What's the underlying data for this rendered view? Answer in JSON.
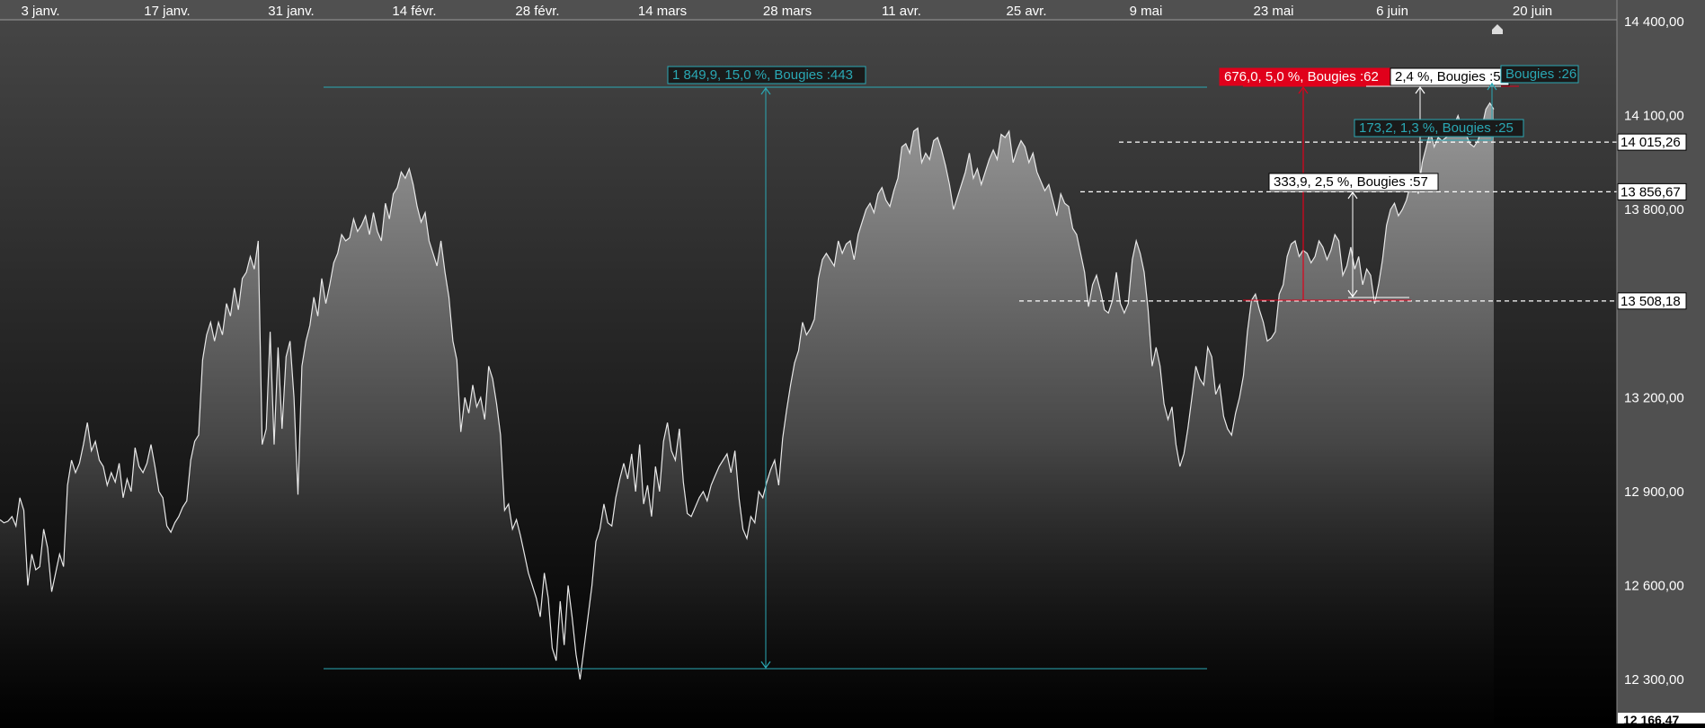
{
  "chart_data": {
    "type": "area",
    "title": "",
    "x_axis": {
      "ticks": [
        "3 janv.",
        "17 janv.",
        "31 janv.",
        "14 févr.",
        "28 févr.",
        "14 mars",
        "28 mars",
        "11 avr.",
        "25 avr.",
        "9 mai",
        "23 mai",
        "6 juin",
        "20 juin"
      ]
    },
    "y_axis": {
      "ticks": [
        14400,
        14100,
        13800,
        13200,
        12900,
        12600,
        12300
      ],
      "tick_labels": [
        "14 400,00",
        "14 100,00",
        "13 800,00",
        "13 200,00",
        "12 900,00",
        "12 600,00",
        "12 300,00"
      ],
      "ylim": [
        12166.47,
        14400
      ],
      "bottom_label": "12 166,47"
    },
    "series": [
      {
        "values": [
          12810,
          12800,
          12805,
          12820,
          12790,
          12880,
          12840,
          12600,
          12700,
          12650,
          12660,
          12780,
          12720,
          12580,
          12640,
          12700,
          12660,
          12920,
          13000,
          12960,
          12990,
          13050,
          13120,
          13030,
          13060,
          13000,
          12980,
          12920,
          12960,
          12930,
          12990,
          12880,
          12940,
          12900,
          13040,
          12980,
          12960,
          12990,
          13050,
          12980,
          12900,
          12880,
          12790,
          12770,
          12800,
          12820,
          12850,
          12870,
          13000,
          13060,
          13080,
          13320,
          13400,
          13440,
          13380,
          13440,
          13400,
          13500,
          13460,
          13550,
          13480,
          13580,
          13600,
          13650,
          13610,
          13700,
          13050,
          13100,
          13410,
          13050,
          13360,
          13100,
          13330,
          13380,
          13200,
          12890,
          13300,
          13380,
          13430,
          13520,
          13460,
          13580,
          13500,
          13560,
          13630,
          13660,
          13720,
          13700,
          13710,
          13770,
          13730,
          13750,
          13780,
          13720,
          13790,
          13730,
          13700,
          13820,
          13770,
          13850,
          13870,
          13920,
          13900,
          13930,
          13880,
          13810,
          13760,
          13790,
          13700,
          13660,
          13620,
          13700,
          13600,
          13520,
          13380,
          13320,
          13090,
          13200,
          13150,
          13240,
          13170,
          13200,
          13130,
          13300,
          13260,
          13180,
          13080,
          12840,
          12860,
          12780,
          12810,
          12760,
          12700,
          12640,
          12600,
          12560,
          12500,
          12640,
          12560,
          12400,
          12360,
          12550,
          12410,
          12600,
          12500,
          12380,
          12300,
          12400,
          12500,
          12600,
          12740,
          12780,
          12860,
          12800,
          12790,
          12880,
          12940,
          12990,
          12940,
          13020,
          12900,
          13050,
          12860,
          12920,
          12820,
          12980,
          12900,
          13060,
          13120,
          13030,
          13000,
          13100,
          12930,
          12830,
          12820,
          12850,
          12880,
          12900,
          12870,
          12920,
          12950,
          12980,
          13000,
          13020,
          12960,
          13030,
          12880,
          12780,
          12750,
          12820,
          12800,
          12900,
          12880,
          12930,
          12970,
          13000,
          12920,
          13070,
          13160,
          13240,
          13310,
          13350,
          13440,
          13400,
          13420,
          13450,
          13580,
          13640,
          13660,
          13640,
          13620,
          13700,
          13660,
          13690,
          13700,
          13640,
          13720,
          13760,
          13800,
          13820,
          13790,
          13850,
          13870,
          13830,
          13810,
          13860,
          13900,
          14000,
          14010,
          13980,
          14050,
          14060,
          13950,
          13980,
          13960,
          14020,
          14030,
          13990,
          13940,
          13880,
          13800,
          13840,
          13880,
          13920,
          13980,
          13900,
          13930,
          13880,
          13920,
          13960,
          13990,
          13960,
          14040,
          14030,
          14050,
          13950,
          13990,
          14020,
          14000,
          13950,
          13980,
          13920,
          13890,
          13860,
          13880,
          13830,
          13780,
          13850,
          13820,
          13810,
          13740,
          13720,
          13660,
          13600,
          13490,
          13560,
          13590,
          13540,
          13480,
          13470,
          13510,
          13600,
          13500,
          13470,
          13500,
          13640,
          13700,
          13660,
          13600,
          13480,
          13300,
          13360,
          13300,
          13180,
          13130,
          13170,
          13050,
          12980,
          13020,
          13100,
          13200,
          13300,
          13260,
          13240,
          13360,
          13330,
          13210,
          13240,
          13140,
          13100,
          13080,
          13150,
          13200,
          13270,
          13410,
          13510,
          13530,
          13480,
          13440,
          13380,
          13390,
          13410,
          13530,
          13560,
          13650,
          13690,
          13700,
          13650,
          13670,
          13660,
          13630,
          13650,
          13700,
          13680,
          13640,
          13670,
          13720,
          13700,
          13590,
          13620,
          13680,
          13610,
          13650,
          13560,
          13610,
          13590,
          13500,
          13560,
          13640,
          13750,
          13800,
          13820,
          13780,
          13800,
          13830,
          13880,
          13900,
          13850,
          13950,
          14000,
          14050,
          14000,
          14030,
          14020,
          14030,
          14040,
          14070,
          14100,
          14060,
          14040,
          14010,
          14000,
          14020,
          14060,
          14120,
          14140,
          14120
        ]
      }
    ],
    "annotations": [
      {
        "label": "1 849,9, 15,0 %, Bougies :443",
        "color": "#2aa8b4"
      },
      {
        "label": "676,0, 5,0 %, Bougies :62",
        "color": "#e0001b"
      },
      {
        "label": "2,4 %, Bougies :57",
        "color": "#ffffff"
      },
      {
        "label": "Bougies :26",
        "color": "#2aa8b4"
      },
      {
        "label": "173,2, 1,3 %, Bougies :25",
        "color": "#2aa8b4"
      },
      {
        "label": "333,9, 2,5 %, Bougies :57",
        "color": "#ffffff"
      }
    ],
    "levels": [
      {
        "value": 14015.26,
        "label": "14 015,26"
      },
      {
        "value": 13856.67,
        "label": "13 856,67"
      },
      {
        "value": 13508.18,
        "label": "13 508,18"
      }
    ],
    "grid": false,
    "legend": "none"
  },
  "colors": {
    "background_top": "#474747",
    "background_bottom": "#000000",
    "axis_panel": "#505050",
    "line": "#e8e8e8",
    "teal": "#2aa8b4",
    "red": "#e0001b"
  }
}
